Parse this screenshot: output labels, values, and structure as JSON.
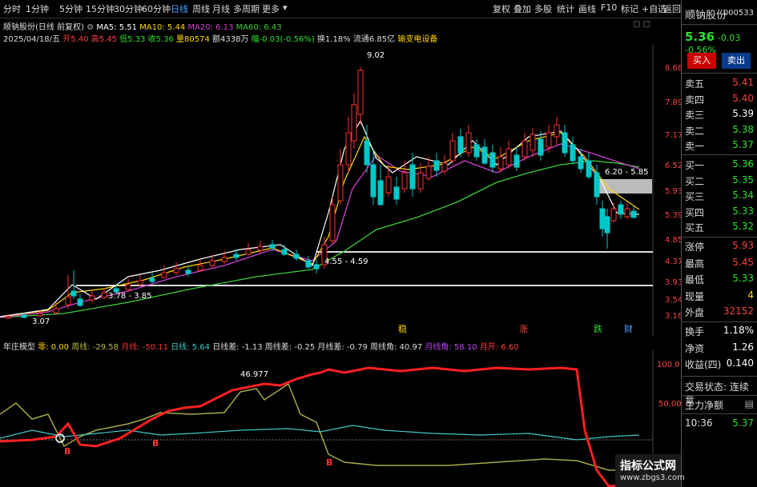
{
  "toolbar": {
    "items": [
      "分时",
      "1分钟",
      "5分钟",
      "15分钟",
      "30分钟",
      "60分钟",
      "日线",
      "周线",
      "月线",
      "多周期",
      "更多"
    ],
    "right": [
      "复权",
      "叠加",
      "多股",
      "统计",
      "画线",
      "F10",
      "标记",
      "+自选",
      "返回"
    ]
  },
  "title_line": {
    "name": "顺钠股份(日线 前复权)",
    "ma5": "MA5: 5.51",
    "ma10": "MA10: 5.44",
    "ma20": "MA20: 6.13",
    "ma60": "MA60: 6.43"
  },
  "info_line": {
    "date": "2025/04/18/五",
    "open": "开5.40",
    "high": "高5.45",
    "low": "低5.33",
    "close": "收5.36",
    "vol": "量80574",
    "amount": "额4338万",
    "change": "幅-0.03(-0.56%)",
    "turnover": "换1.18%",
    "float": "流通6.85亿",
    "sector": "输变电设备"
  },
  "price_axis": [
    "8.68",
    "7.89",
    "7.17",
    "6.52",
    "5.93",
    "5.39",
    "4.85",
    "4.37",
    "3.93",
    "3.54",
    "3.18"
  ],
  "annotations": {
    "high": "9.02",
    "low": "3.07",
    "box1": "3.78 - 3.85",
    "box2": "4.55 - 4.59",
    "box3": "6.20 - 5.85"
  },
  "markers": [
    "稳",
    "涨",
    "跌",
    "财"
  ],
  "indicator": {
    "name": "年庄模型",
    "zero": "零: 0.00",
    "zhouxian": "周线: -29.58",
    "yuexian": "月线: -50.11",
    "rixian": "日线: 5.64",
    "rixiancha": "日线差: -1.13",
    "zhouxiancha": "周线差: -0.25",
    "yuexiancha": "月线差: -0.79",
    "zhouxianjiao": "周线角: 40.97",
    "yuexianjiao": "月线角: 58.10",
    "yuekai": "月开: 6.60",
    "axis": [
      "100.0",
      "50.00"
    ],
    "peak_label": "46.977",
    "b_labels": [
      "B",
      "B",
      "B"
    ]
  },
  "right_panel": {
    "stock_name": "顺钠股份",
    "code": "000533",
    "price": "5.36",
    "chg": "-0.03",
    "pct": "-0.56%",
    "buy_btn": "买入",
    "sell_btn": "卖出",
    "asks": [
      [
        "卖五",
        "5.41"
      ],
      [
        "卖四",
        "5.40"
      ],
      [
        "卖三",
        "5.39"
      ],
      [
        "卖二",
        "5.38"
      ],
      [
        "卖一",
        "5.37"
      ]
    ],
    "bids": [
      [
        "买一",
        "5.36"
      ],
      [
        "买二",
        "5.35"
      ],
      [
        "买三",
        "5.34"
      ],
      [
        "买四",
        "5.33"
      ],
      [
        "买五",
        "5.32"
      ]
    ],
    "stats": [
      [
        "涨停",
        "5.93"
      ],
      [
        "最高",
        "5.45"
      ],
      [
        "最低",
        "5.33"
      ],
      [
        "现量",
        "4"
      ],
      [
        "外盘",
        "32152"
      ]
    ],
    "stats2": [
      [
        "换手",
        "1.18%"
      ],
      [
        "净资",
        "1.26"
      ],
      [
        "收益(四)",
        "0.140"
      ]
    ],
    "trade_status": "交易状态: 连续竞",
    "main_flow": "主力净额",
    "time": "10:36",
    "last": "5.37"
  },
  "watermark": {
    "line1": "指标公式网",
    "line2": "www.zbgs3.com"
  },
  "colors": {
    "up": "#ff3030",
    "down": "#00c8c8",
    "ma5": "#ffffff",
    "ma10": "#ffd800",
    "ma20": "#d040d0",
    "ma60": "#3ad03a"
  }
}
